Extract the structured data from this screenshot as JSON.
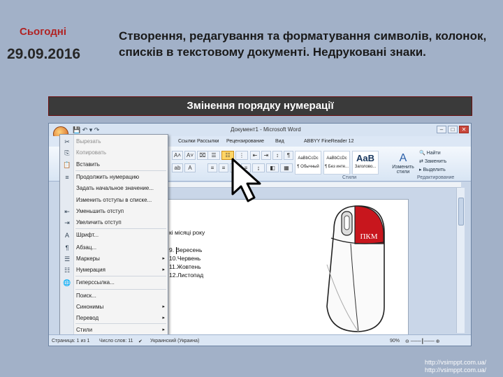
{
  "header": {
    "today_label": "Сьогодні",
    "date": "29.09.2016",
    "title": "Створення, редагування та форматування символів, колонок, списків в текстовому документі. Недруковані знаки.",
    "banner": "Змінення порядку нумерації"
  },
  "word": {
    "window_title": "Документ1 - Microsoft Word",
    "tabs": [
      "Ссылки",
      "Рассылки",
      "Рецензирование",
      "Вид",
      "ABBYY FineReader 12"
    ],
    "styles": [
      {
        "preview": "AaBbCcDc",
        "name": "¶ Обычный"
      },
      {
        "preview": "AaBbCcDc",
        "name": "¶ Без инте..."
      },
      {
        "preview": "AaB",
        "name": "Заголово..."
      }
    ],
    "change_styles": "Изменить стили",
    "group_styles": "Стили",
    "group_editing": "Редактирование",
    "find": "Найти",
    "replace": "Заменить",
    "select": "Выделить",
    "doc_lines": [
      "кі місяці року",
      "9.  Вересень",
      "10.Червень",
      "11.Жовтень",
      "12.Листопад"
    ],
    "mouse_label": "ПКМ",
    "status": {
      "page": "Страница: 1 из 1",
      "words": "Число слов: 11",
      "lang": "Украинский (Украина)",
      "zoom": "90%"
    }
  },
  "context_menu": {
    "items": [
      {
        "label": "Вырезать",
        "icon": "✂",
        "disabled": true
      },
      {
        "label": "Копировать",
        "icon": "⎘",
        "disabled": true
      },
      {
        "label": "Вставить",
        "icon": "📋"
      },
      {
        "label": "Продолжить нумерацию",
        "icon": "≡"
      },
      {
        "label": "Задать начальное значение...",
        "icon": ""
      },
      {
        "label": "Изменить отступы в списке...",
        "icon": ""
      },
      {
        "label": "Уменьшить отступ",
        "icon": "⇤"
      },
      {
        "label": "Увеличить отступ",
        "icon": "⇥"
      },
      {
        "label": "Шрифт...",
        "icon": "A"
      },
      {
        "label": "Абзац...",
        "icon": "¶"
      },
      {
        "label": "Маркеры",
        "icon": "☰",
        "submenu": true
      },
      {
        "label": "Нумерация",
        "icon": "☷",
        "submenu": true
      },
      {
        "label": "Гиперссылка...",
        "icon": "🌐"
      },
      {
        "label": "Поиск...",
        "icon": ""
      },
      {
        "label": "Синонимы",
        "icon": "",
        "submenu": true
      },
      {
        "label": "Перевод",
        "icon": "",
        "submenu": true
      },
      {
        "label": "Стили",
        "icon": "",
        "submenu": true
      }
    ]
  },
  "watermark": [
    "http://vsimppt.com.ua/",
    "http://vsimppt.com.ua/"
  ]
}
